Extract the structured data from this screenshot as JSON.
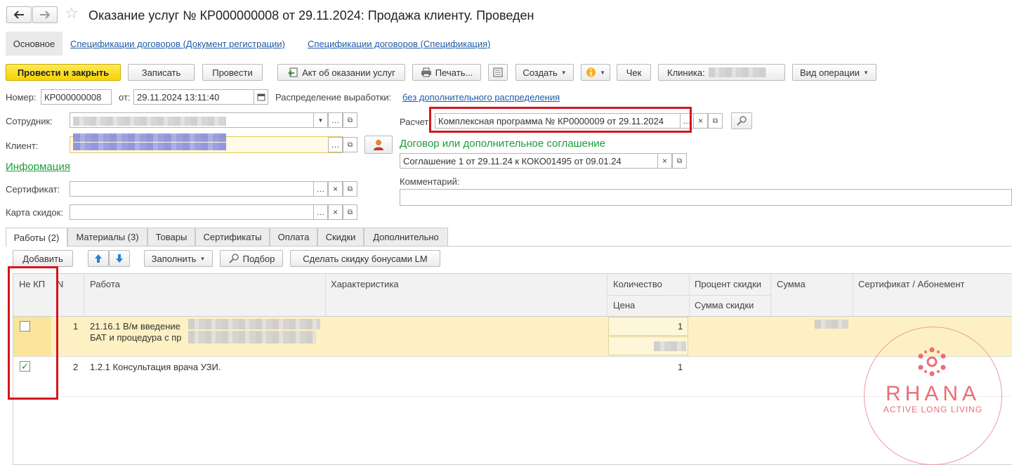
{
  "window": {
    "title": "Оказание услуг № КР000000008 от 29.11.2024: Продажа клиенту.  Проведен"
  },
  "nav_tabs": {
    "main": "Основное",
    "link1": "Спецификации договоров (Документ регистрации)",
    "link2": "Спецификации договоров (Спецификация)"
  },
  "toolbar": {
    "post_close": "Провести и закрыть",
    "save": "Записать",
    "post": "Провести",
    "act": "Акт об оказании услуг",
    "print": "Печать...",
    "create": "Создать",
    "receipt": "Чек",
    "clinic_label": "Клиника:",
    "operation_type": "Вид операции"
  },
  "header": {
    "number_label": "Номер:",
    "number_value": "КР000000008",
    "date_label": "от:",
    "date_value": "29.11.2024 13:11:40",
    "distribution_label": "Распределение выработки:",
    "distribution_value": "без дополнительного распределения",
    "employee_label": "Сотрудник:",
    "client_label": "Клиент:",
    "info_link": "Информация",
    "certificate_label": "Сертификат:",
    "discount_card_label": "Карта скидок:",
    "calc_label": "Расчет",
    "calc_value": "Комплексная программа № КР0000009 от 29.11.2024",
    "contract_header": "Договор или дополнительное соглашение",
    "contract_value": "Соглашение 1 от 29.11.24 к КОКО01495 от 09.01.24",
    "comment_label": "Комментарий:"
  },
  "tabs": [
    {
      "label": "Работы (2)"
    },
    {
      "label": "Материалы (3)"
    },
    {
      "label": "Товары"
    },
    {
      "label": "Сертификаты"
    },
    {
      "label": "Оплата"
    },
    {
      "label": "Скидки"
    },
    {
      "label": "Дополнительно"
    }
  ],
  "table_toolbar": {
    "add": "Добавить",
    "fill": "Заполнить",
    "pick": "Подбор",
    "bonus": "Сделать скидку бонусами LM"
  },
  "table": {
    "columns": {
      "not_kp": "Не КП",
      "n": "N",
      "work": "Работа",
      "characteristic": "Характеристика",
      "quantity": "Количество",
      "price": "Цена",
      "discount_percent": "Процент скидки",
      "discount_sum": "Сумма скидки",
      "sum": "Сумма",
      "certificate": "Сертификат / Абонемент"
    },
    "rows": [
      {
        "not_kp": false,
        "n": "1",
        "work_line1": "21.16.1 В/м введение",
        "work_line2": "БАТ и процедура с пр",
        "quantity": "1"
      },
      {
        "not_kp": true,
        "n": "2",
        "work_line1": "1.2.1 Консультация врача УЗИ.",
        "work_line2": "",
        "quantity": "1"
      }
    ]
  },
  "watermark": {
    "brand": "RHANA",
    "tagline": "ACTIVE LONG LIVING"
  },
  "colors": {
    "accent_yellow": "#f6d500",
    "selected_row": "#fdf1c4",
    "highlight_red": "#d4161c",
    "link_blue": "#1f5ba8",
    "green_header": "#1e9b3a",
    "watermark": "#e8707a"
  }
}
